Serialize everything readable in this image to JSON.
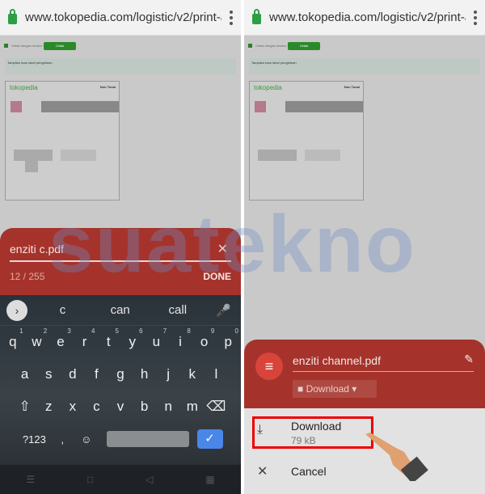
{
  "url": "www.tokopedia.com/logistic/v2/print-a",
  "page": {
    "checkbox_label": "Cetak dengan invoice",
    "print_button": "Cetak",
    "info_title": "Tampilan baru label pengiriman",
    "logo": "tokopedia",
    "label_badge": "Non Tunai"
  },
  "left": {
    "filename": "enziti c.pdf",
    "char_count": "12 / 255",
    "done": "DONE",
    "suggestions": [
      "c",
      "can",
      "call"
    ],
    "row1": [
      "q",
      "w",
      "e",
      "r",
      "t",
      "y",
      "u",
      "i",
      "o",
      "p"
    ],
    "row1_hints": [
      "1",
      "2",
      "3",
      "4",
      "5",
      "6",
      "7",
      "8",
      "9",
      "0"
    ],
    "row2": [
      "a",
      "s",
      "d",
      "f",
      "g",
      "h",
      "j",
      "k",
      "l"
    ],
    "row3": [
      "z",
      "x",
      "c",
      "v",
      "b",
      "n",
      "m"
    ],
    "sym": "?123",
    "comma": ","
  },
  "right": {
    "filename": "enziti channel.pdf",
    "folder": "Download",
    "download_label": "Download",
    "download_size": "79 kB",
    "cancel_label": "Cancel"
  },
  "watermark": "suatekno",
  "colors": {
    "sheet": "#a5332b",
    "highlight": "#e00000",
    "accent": "#4a86e8"
  }
}
